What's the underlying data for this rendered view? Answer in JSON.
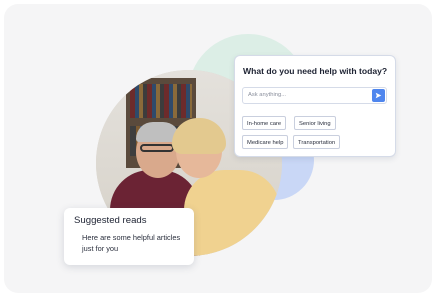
{
  "chat": {
    "title": "What do you need help with today?",
    "placeholder": "Ask anything...",
    "chips": [
      "In-home care",
      "Senior living",
      "Medicare help",
      "Transportation"
    ]
  },
  "reads": {
    "title": "Suggested reads",
    "body": "Here are some helpful articles just for you"
  },
  "icons": {
    "send": "send-arrow-icon"
  },
  "colors": {
    "accent": "#4f86ee",
    "green_blob": "#dceee6",
    "blue_blob": "#c9d7f6"
  }
}
